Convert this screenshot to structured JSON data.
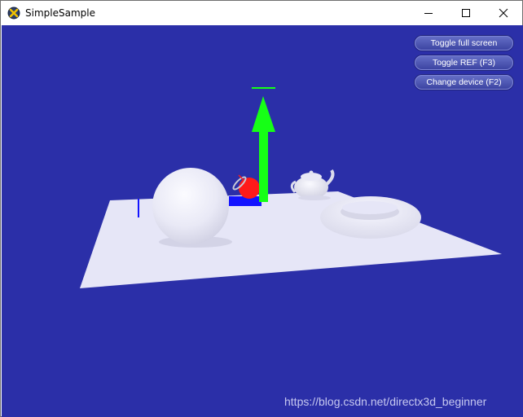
{
  "window": {
    "title": "SimpleSample",
    "controls": {
      "minimize_icon": "minimize-icon",
      "maximize_icon": "maximize-icon",
      "close_icon": "close-icon"
    }
  },
  "hud": {
    "buttons": [
      {
        "label": "Toggle full screen"
      },
      {
        "label": "Toggle REF (F3)"
      },
      {
        "label": "Change device (F2)"
      }
    ]
  },
  "watermark": {
    "text": "https://blog.csdn.net/directx3d_beginner"
  },
  "colors": {
    "background": "#2b2fa8",
    "floor": "#e6e6f7",
    "axis_up": "#16ff16",
    "axis_x": "#ff1a1a",
    "axis_z": "#1414ff",
    "hud_button": "#4a52b4"
  }
}
